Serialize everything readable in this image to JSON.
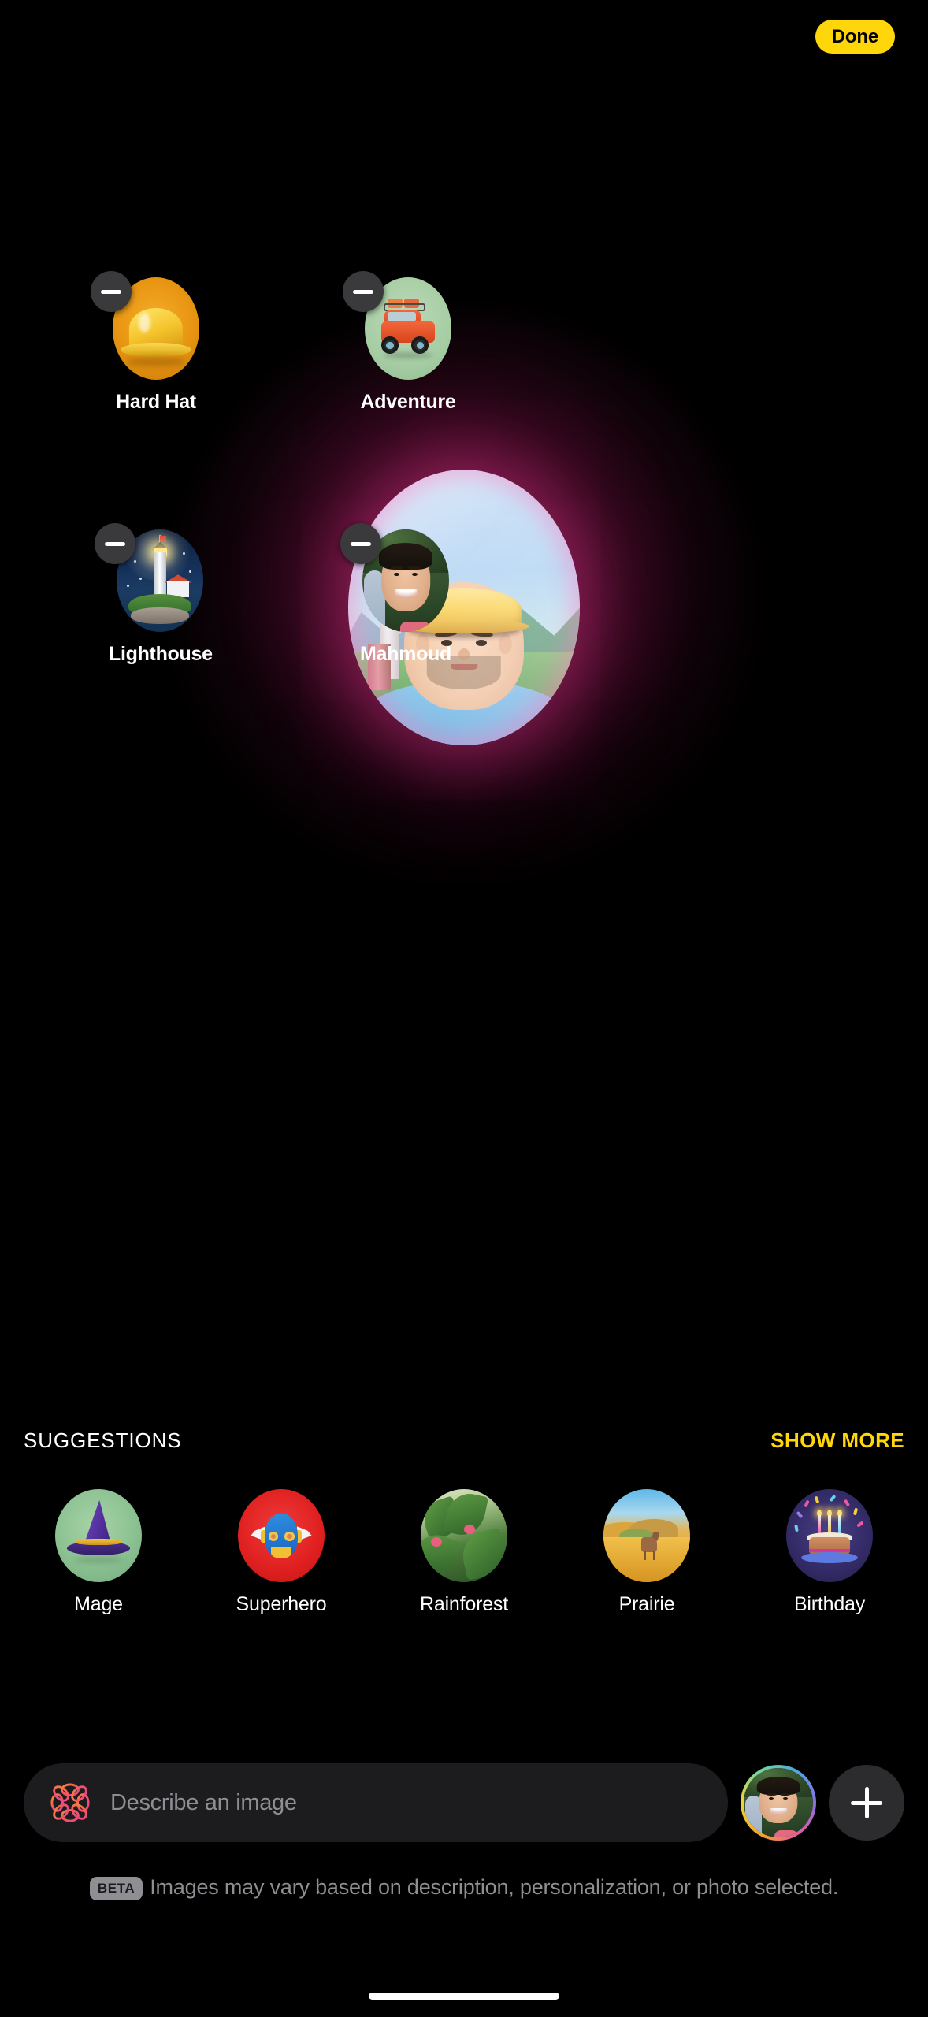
{
  "header": {
    "done_label": "Done"
  },
  "canvas": {
    "main_image_alt": "generated-portrait-hard-hat",
    "concepts": [
      {
        "id": "hard-hat",
        "label": "Hard Hat",
        "kind": "concept",
        "remove_icon": "minus-icon",
        "accent": "#E89512"
      },
      {
        "id": "adventure",
        "label": "Adventure",
        "kind": "concept",
        "remove_icon": "minus-icon",
        "accent": "#A6CDA3"
      },
      {
        "id": "lighthouse",
        "label": "Lighthouse",
        "kind": "concept",
        "remove_icon": "minus-icon",
        "accent": "#15315B"
      },
      {
        "id": "mahmoud",
        "label": "Mahmoud",
        "kind": "person",
        "remove_icon": "minus-icon",
        "accent": "#3E5C34"
      }
    ]
  },
  "suggestions": {
    "title": "SUGGESTIONS",
    "show_more_label": "SHOW MORE",
    "items": [
      {
        "id": "mage",
        "label": "Mage",
        "accent": "#8CC192"
      },
      {
        "id": "superhero",
        "label": "Superhero",
        "accent": "#E02020"
      },
      {
        "id": "rainforest",
        "label": "Rainforest",
        "accent": "#4E7F3C"
      },
      {
        "id": "prairie",
        "label": "Prairie",
        "accent": "#E8A836"
      },
      {
        "id": "birthday",
        "label": "Birthday",
        "accent": "#342C68"
      }
    ]
  },
  "composer": {
    "icon": "image-playground-icon",
    "placeholder": "Describe an image",
    "avatar_icon": "person-avatar",
    "add_label": "+",
    "add_icon": "plus-icon"
  },
  "footer": {
    "beta_badge": "BETA",
    "disclaimer": "Images may vary based on description, personalization, or photo selected."
  },
  "theme": {
    "background": "#000000",
    "accent_yellow": "#FFD60A",
    "field_background": "#1C1C1E",
    "secondary_text": "#8E8E93"
  }
}
